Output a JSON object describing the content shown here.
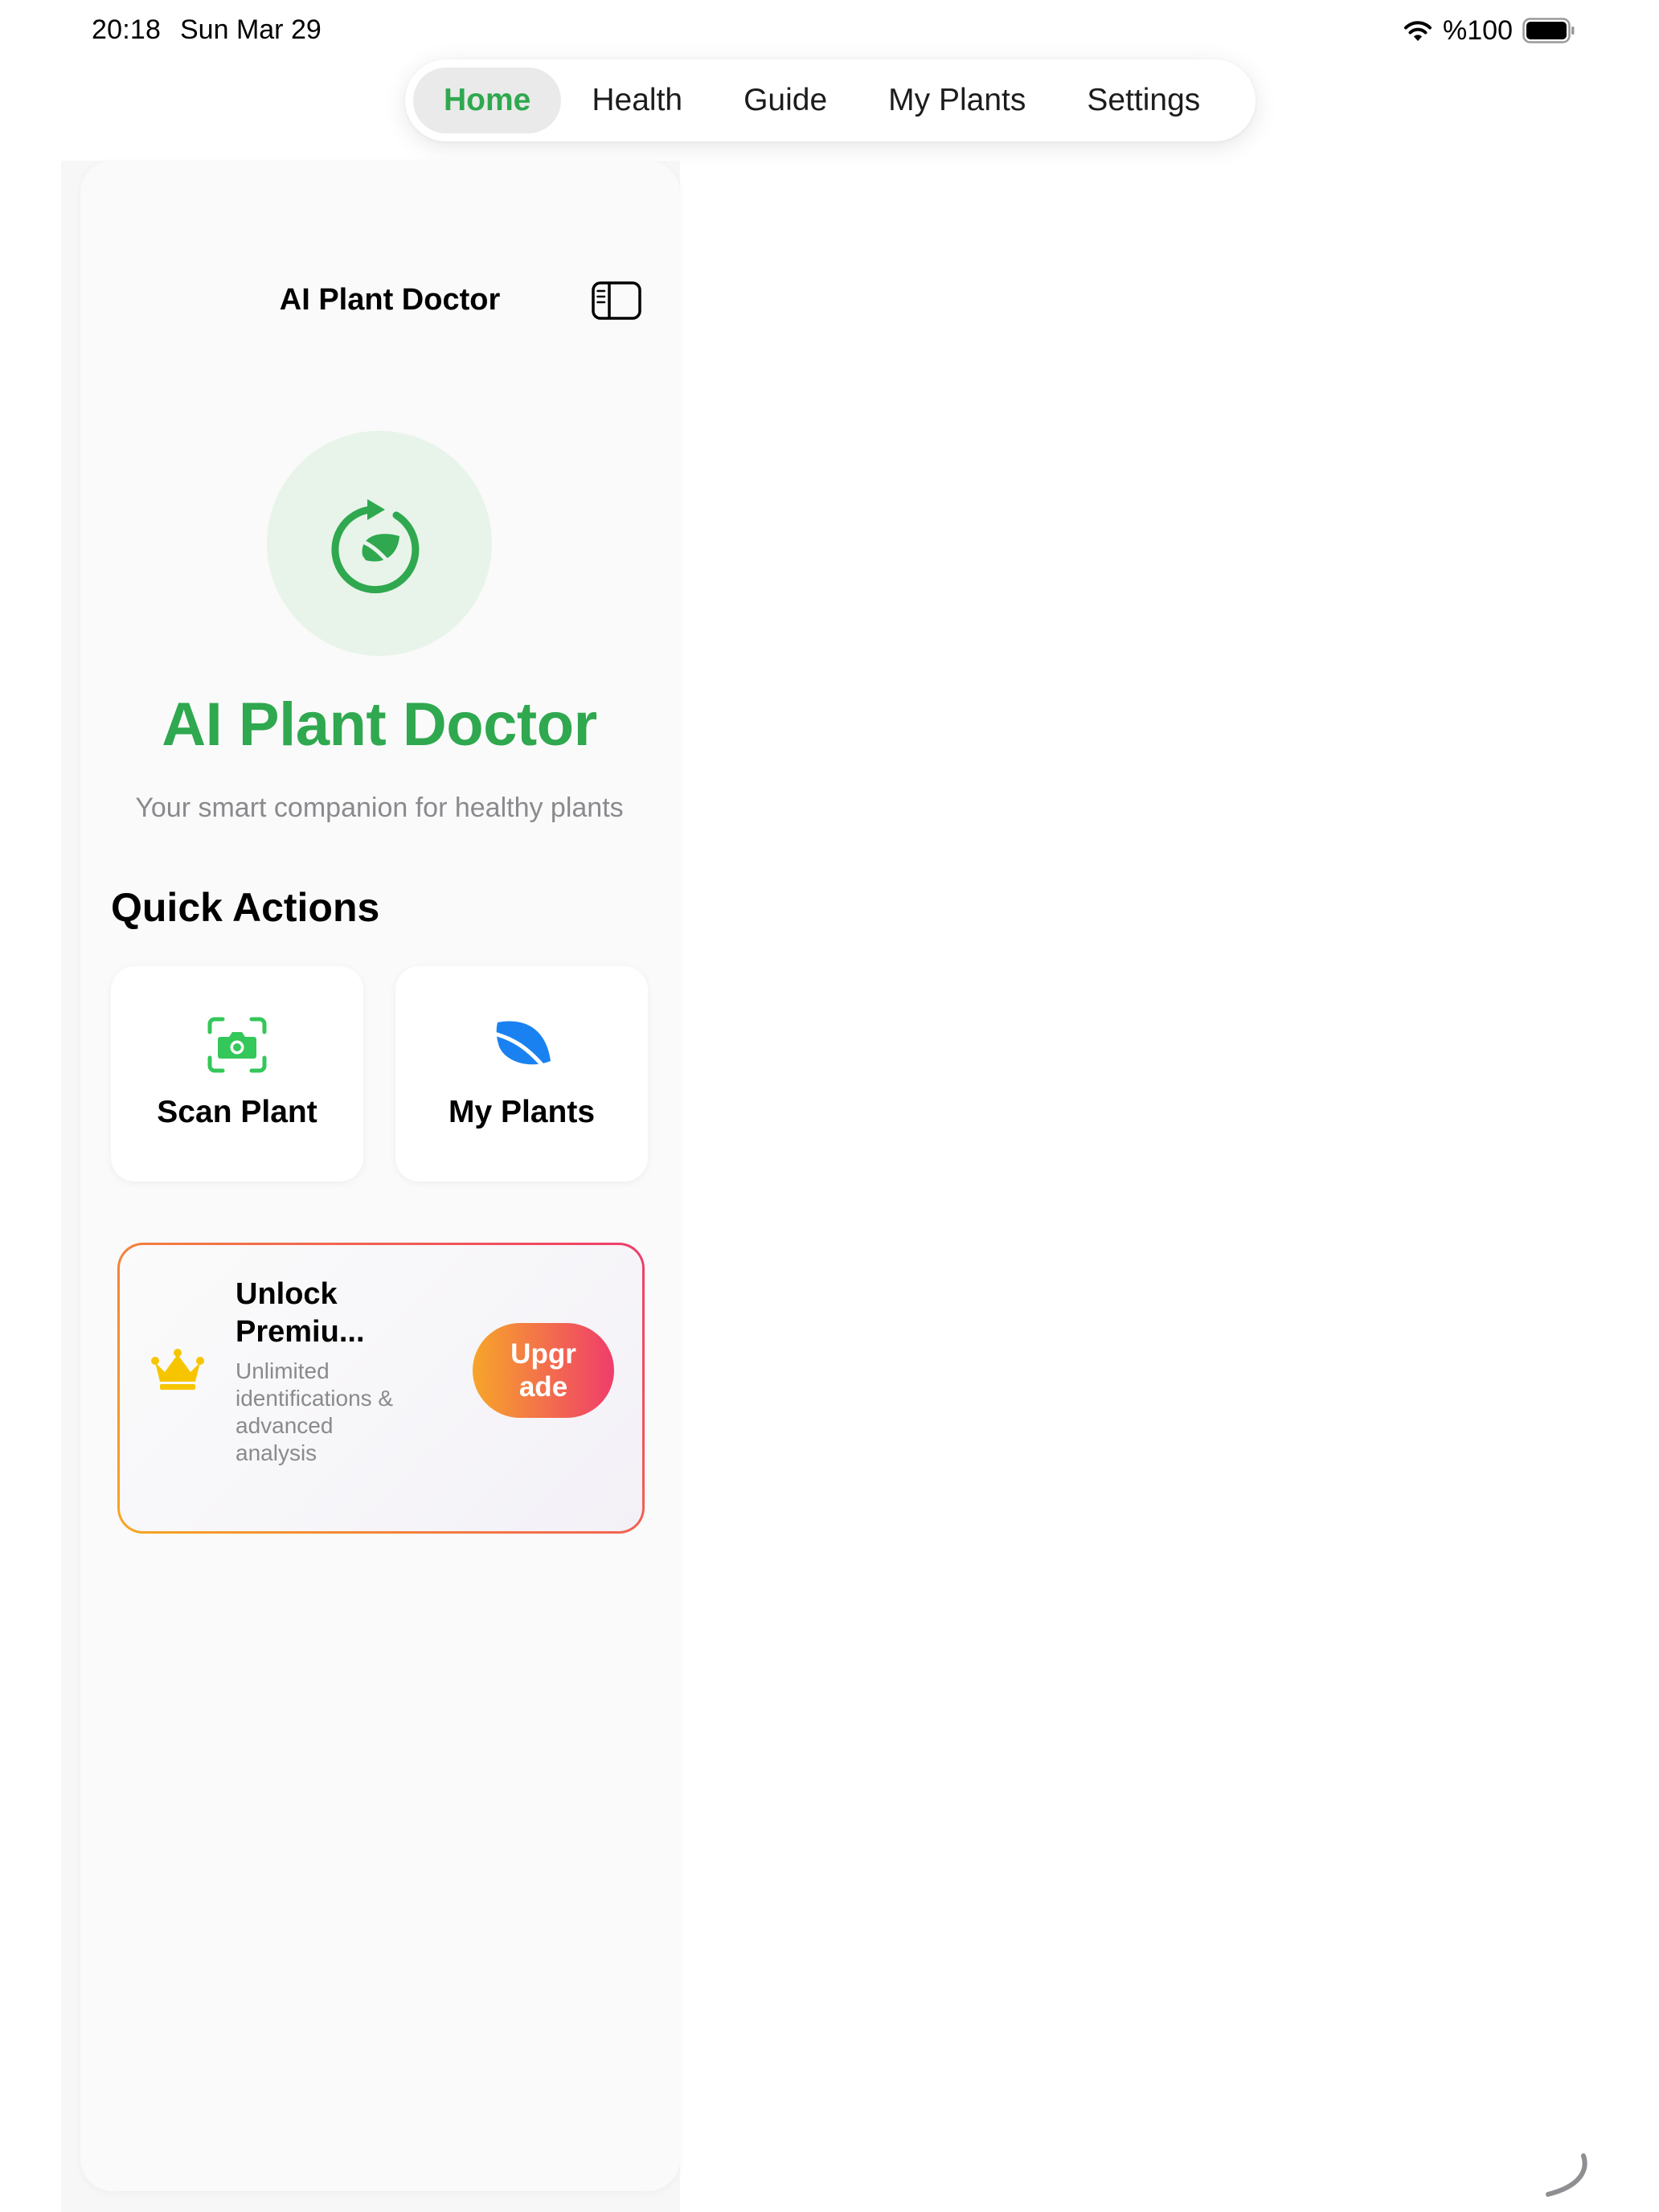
{
  "status_bar": {
    "time": "20:18",
    "date": "Sun Mar 29",
    "battery_percent": "%100",
    "battery_level": 1.0
  },
  "tabs": [
    {
      "label": "Home",
      "active": true
    },
    {
      "label": "Health",
      "active": false
    },
    {
      "label": "Guide",
      "active": false
    },
    {
      "label": "My Plants",
      "active": false
    },
    {
      "label": "Settings",
      "active": false
    }
  ],
  "sidebar": {
    "title": "AI Plant Doctor",
    "toggle_icon": "sidebar-toggle-icon"
  },
  "hero": {
    "icon": "plant-refresh-icon",
    "app_name": "AI Plant Doctor",
    "tagline": "Your smart companion for healthy plants"
  },
  "quick_actions": {
    "title": "Quick Actions",
    "items": [
      {
        "label": "Scan Plant",
        "icon": "camera-scan-icon"
      },
      {
        "label": "My Plants",
        "icon": "leaf-icon"
      }
    ]
  },
  "premium": {
    "icon": "crown-icon",
    "title": "Unlock Premiu...",
    "description": "Unlimited identifications & advanced analysis",
    "button_label": "Upgrade"
  },
  "colors": {
    "accent_green": "#2fa84f",
    "leaf_blue": "#1a82f0",
    "crown_yellow": "#f7c500",
    "gradient_start": "#f7a52a",
    "gradient_end": "#ef3d6b"
  }
}
